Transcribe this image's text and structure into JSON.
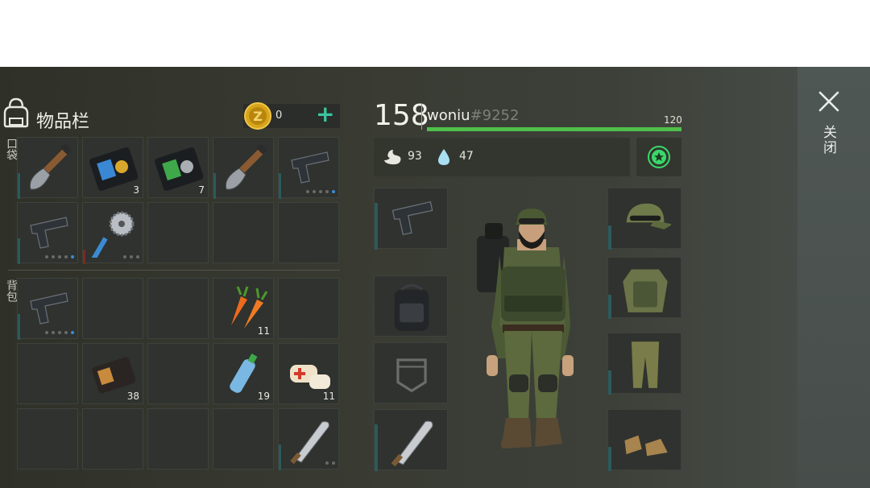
{
  "inventory": {
    "title": "物品栏",
    "coins": "0",
    "add_label": "+",
    "pockets_label": "口袋",
    "backpack_label": "背包",
    "pockets": [
      {
        "item": "shovel",
        "count": ""
      },
      {
        "item": "police-badge",
        "count": "3"
      },
      {
        "item": "id-badge",
        "count": "7"
      },
      {
        "item": "shovel",
        "count": ""
      },
      {
        "item": "pistol",
        "count": ""
      },
      {
        "item": "pistol",
        "count": ""
      },
      {
        "item": "saw-club",
        "count": ""
      },
      {
        "item": "",
        "count": ""
      },
      {
        "item": "",
        "count": ""
      },
      {
        "item": "",
        "count": ""
      }
    ],
    "backpack": [
      {
        "item": "pistol",
        "count": ""
      },
      {
        "item": "",
        "count": ""
      },
      {
        "item": "",
        "count": ""
      },
      {
        "item": "carrots",
        "count": "11"
      },
      {
        "item": "",
        "count": ""
      },
      {
        "item": "",
        "count": ""
      },
      {
        "item": "wallet",
        "count": "38"
      },
      {
        "item": "",
        "count": ""
      },
      {
        "item": "water-bottle",
        "count": "19"
      },
      {
        "item": "bandage",
        "count": "11"
      },
      {
        "item": "",
        "count": ""
      },
      {
        "item": "",
        "count": ""
      },
      {
        "item": "",
        "count": ""
      },
      {
        "item": "",
        "count": ""
      },
      {
        "item": "machete",
        "count": ""
      }
    ]
  },
  "player": {
    "level": "158",
    "name": "woniu",
    "tag": "#9252",
    "xp_value": "120",
    "xp_fraction": 1.0,
    "food": "93",
    "water": "47",
    "colors": {
      "xp": "#4fbf4a",
      "accent": "#3ad86a"
    }
  },
  "equipment": {
    "left": [
      "pistol",
      "backpack",
      "pocket-empty",
      "machete"
    ],
    "right": [
      "camo-cap",
      "body-armor",
      "camo-pants",
      "boots"
    ]
  },
  "close_label": "关闭"
}
